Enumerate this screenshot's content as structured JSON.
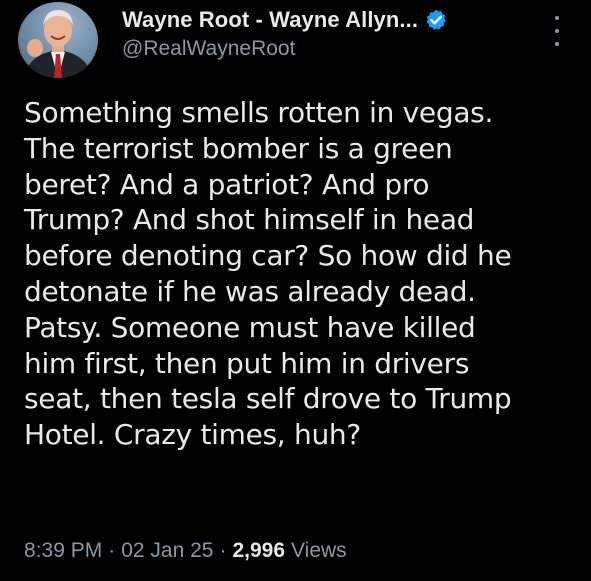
{
  "author": {
    "display_name": "Wayne Root - Wayne Allyn...",
    "handle": "@RealWayneRoot",
    "verified": true,
    "verified_color": "#1d9bf0"
  },
  "tweet": {
    "lines": [
      "Something smells rotten in vegas.",
      "The terrorist bomber is a green",
      "beret? And a patriot? And pro",
      "Trump? And shot himself in head",
      "before denoting car? So how did he",
      "detonate if he was already dead.",
      "Patsy. Someone must have killed",
      "him first, then put him in drivers",
      "seat, then tesla self drove to Trump",
      "Hotel. Crazy times, huh?"
    ]
  },
  "meta": {
    "time": "8:39 PM",
    "separator": "·",
    "date": "02 Jan 25",
    "views_count": "2,996",
    "views_label": "Views"
  },
  "icons": {
    "more": "more-vertical-icon",
    "verified": "verified-badge-icon"
  }
}
